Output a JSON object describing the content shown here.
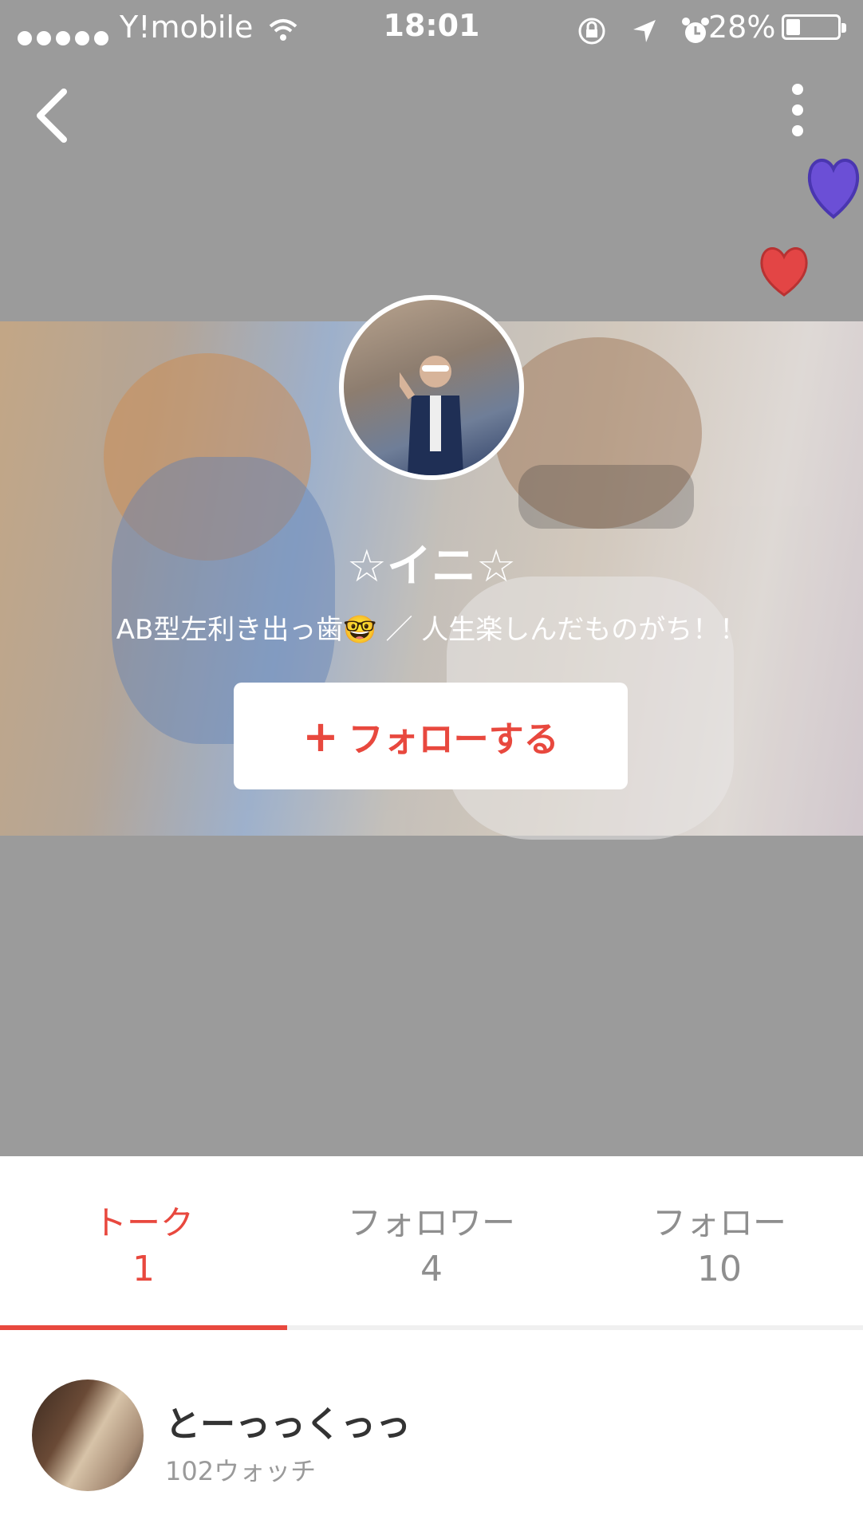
{
  "status_bar": {
    "carrier": "Y!mobile",
    "time": "18:01",
    "battery_percent": "28%",
    "battery_level": 0.28
  },
  "profile": {
    "name": "☆イニ☆",
    "bio": "AB型左利き出っ歯🤓 ／ 人生楽しんだものがち！！",
    "follow_button": {
      "icon": "+",
      "label": "フォローする"
    }
  },
  "tabs": [
    {
      "label": "トーク",
      "count": "1",
      "active": true
    },
    {
      "label": "フォロワー",
      "count": "4",
      "active": false
    },
    {
      "label": "フォロー",
      "count": "10",
      "active": false
    }
  ],
  "list": [
    {
      "title": "とーっっくっっ",
      "subtitle": "102ウォッチ"
    }
  ],
  "colors": {
    "accent": "#e8483e",
    "overlay_gray": "#9b9b9b",
    "muted_text": "#8e8e8e"
  },
  "icons": [
    "back-chevron-icon",
    "more-vertical-icon",
    "wifi-icon",
    "rotation-lock-icon",
    "location-arrow-icon",
    "alarm-icon",
    "battery-icon",
    "heart-sticker-icon"
  ]
}
